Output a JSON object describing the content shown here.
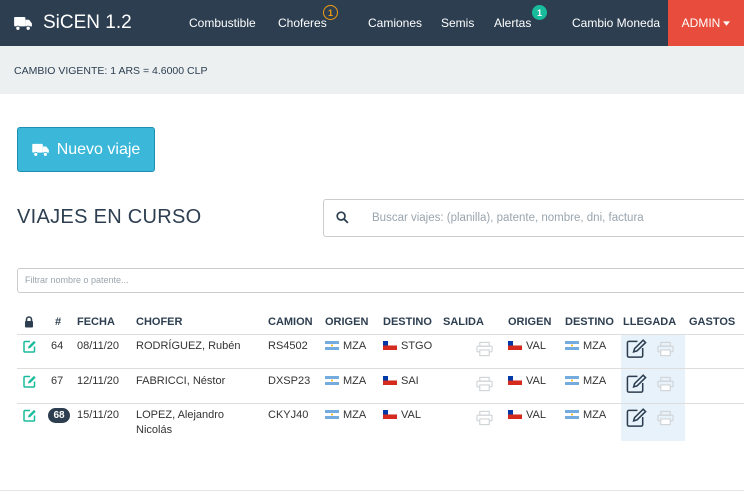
{
  "navbar": {
    "brand": "SiCEN 1.2",
    "items": [
      {
        "label": "Combustible",
        "badge": null
      },
      {
        "label": "Choferes",
        "badge": "1"
      },
      {
        "label": "Camiones",
        "badge": null
      },
      {
        "label": "Semis",
        "badge": null
      },
      {
        "label": "Alertas",
        "badge": "1"
      },
      {
        "label": "Cambio Moneda",
        "badge": null
      }
    ],
    "admin_label": "ADMIN"
  },
  "exchange": {
    "text": "CAMBIO VIGENTE: 1 ARS = 4.6000 CLP"
  },
  "new_trip_button": "Nuevo viaje",
  "section_title": "VIAJES EN CURSO",
  "search": {
    "placeholder": "Buscar viajes: (planilla), patente, nombre, dni, factura"
  },
  "filter": {
    "placeholder": "Filtrar nombre o patente..."
  },
  "table": {
    "headers": {
      "num": "#",
      "fecha": "FECHA",
      "chofer": "CHOFER",
      "camion": "CAMION",
      "origen": "ORIGEN",
      "destino": "DESTINO",
      "salida": "SALIDA",
      "origen2": "ORIGEN",
      "destino2": "DESTINO",
      "llegada": "LLEGADA",
      "gastos": "GASTOS"
    },
    "rows": [
      {
        "id": "64",
        "highlight": false,
        "fecha": "08/11/20",
        "chofer": "RODRÍGUEZ, Rubén",
        "camion": "RS4502",
        "origen": "MZA",
        "destino": "STGO",
        "origen2": "VAL",
        "destino2": "MZA"
      },
      {
        "id": "67",
        "highlight": false,
        "fecha": "12/11/20",
        "chofer": "FABRICCI, Néstor",
        "camion": "DXSP23",
        "origen": "MZA",
        "destino": "SAI",
        "origen2": "VAL",
        "destino2": "MZA"
      },
      {
        "id": "68",
        "highlight": true,
        "fecha": "15/11/20",
        "chofer": "LOPEZ, Alejandro Nicolás",
        "camion": "CKYJ40",
        "origen": "MZA",
        "destino": "VAL",
        "origen2": "VAL",
        "destino2": "MZA"
      }
    ]
  },
  "colors": {
    "navbar": "#2c3e50",
    "admin": "#e74c3c",
    "button": "#3bb8d9",
    "edit_icon": "#18bc9c",
    "badge_orange": "#f39c12",
    "badge_green": "#18bc9c",
    "llegada_bg": "#e8f2fb"
  },
  "icons": [
    "truck-icon",
    "search-icon",
    "edit-icon",
    "printer-icon",
    "pen-square-icon",
    "lock-icon",
    "flag-argentina-icon",
    "flag-chile-icon",
    "caret-down-icon"
  ]
}
